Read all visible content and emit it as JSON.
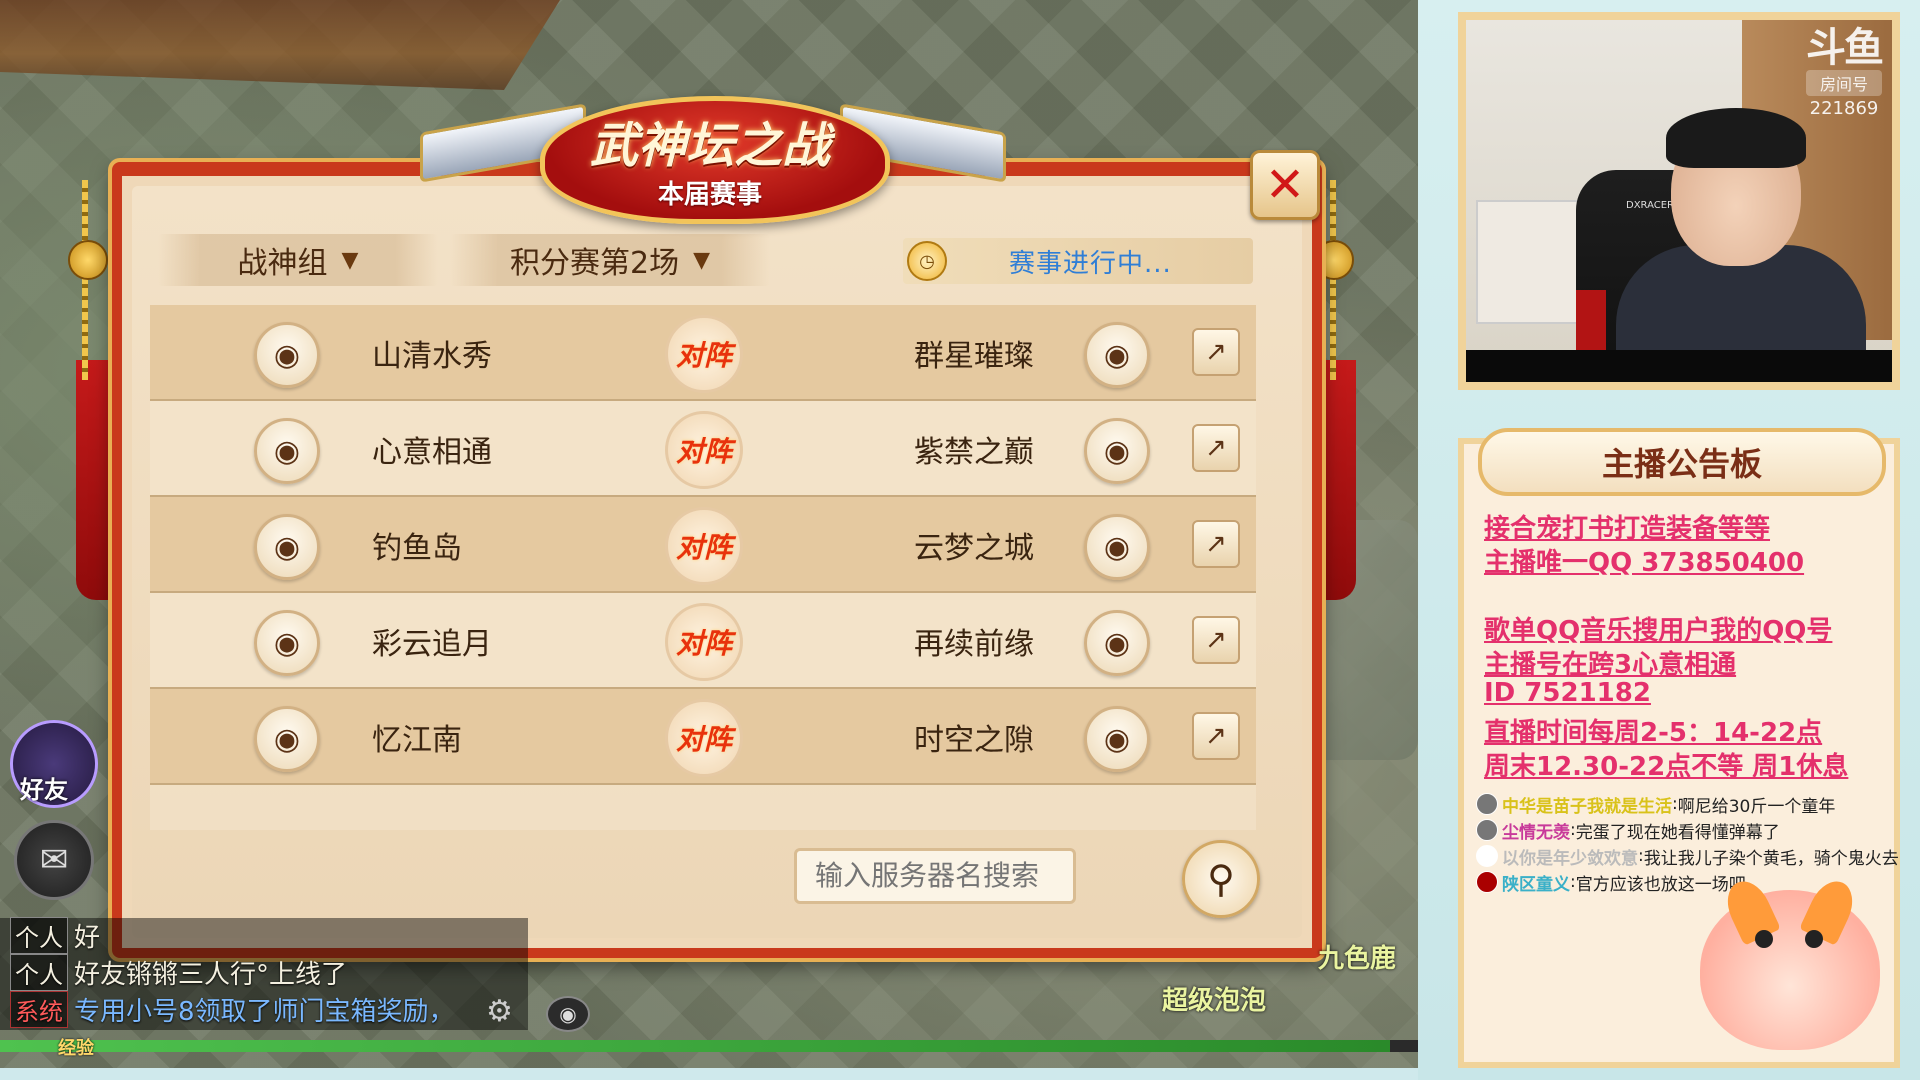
{
  "modal": {
    "title": "武神坛之战",
    "subtitle": "本届赛事",
    "close_label": "✕",
    "filters": {
      "group": "战神组",
      "round": "积分赛第2场",
      "status": "赛事进行中..."
    },
    "vs_label": "对阵",
    "matches": [
      {
        "left": "山清水秀",
        "right": "群星璀璨"
      },
      {
        "left": "心意相通",
        "right": "紫禁之巅"
      },
      {
        "left": "钓鱼岛",
        "right": "云梦之城"
      },
      {
        "left": "彩云追月",
        "right": "再续前缘"
      },
      {
        "left": "忆江南",
        "right": "时空之隙"
      }
    ],
    "search_placeholder": "输入服务器名搜索"
  },
  "game_ui": {
    "friend_label": "好友",
    "chat_lines": [
      {
        "tag": "个人",
        "text": "好",
        "sys": false
      },
      {
        "tag": "个人",
        "text": "好友锵锵三人行°上线了",
        "sys": false
      },
      {
        "tag": "系统",
        "text": "专用小号8领取了师门宝箱奖励，",
        "sys": true
      }
    ],
    "exp_label": "经验",
    "exp_progress": 0.98,
    "npc_names": [
      "超级泡泡",
      "九色鹿"
    ]
  },
  "stream": {
    "logo_text": "斗鱼",
    "room_label": "房间号",
    "room_number": "221869",
    "chair_brand": "DXRACER",
    "board_title": "主播公告板",
    "notices": [
      "接合宠打书打造装备等等",
      "主播唯一QQ 373850400",
      "",
      "歌单QQ音乐搜用户我的QQ号",
      "主播号在跨3心意相通",
      "ID 7521182",
      "直播时间每周2-5：14-22点",
      "周末12.30-22点不等 周1休息"
    ],
    "danmaku": [
      {
        "name": "中华是苗子我就是生活",
        "text": "啊尼给30斤一个童年",
        "name_color": "#d9c21a"
      },
      {
        "name": "尘情无羡",
        "text": "完蛋了现在她看得懂弹幕了",
        "name_color": "#c83a9a"
      },
      {
        "name": "以你是年少敛欢意",
        "text": "我让我儿子染个黄毛，骑个鬼火去",
        "name_color": "#bbbbbb"
      },
      {
        "name": "陕区童义",
        "text": "官方应该也放这一场吧",
        "name_color": "#3ab0c8"
      }
    ]
  }
}
